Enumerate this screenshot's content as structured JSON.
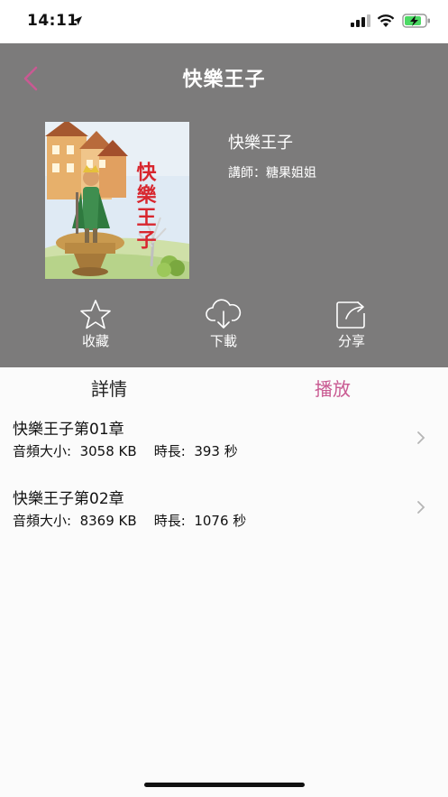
{
  "status_bar": {
    "time": "14:11"
  },
  "header": {
    "title": "快樂王子",
    "accent_color": "#c95a92",
    "book_title": "快樂王子",
    "teacher": "講師：糖果姐姐",
    "cover_text": "快樂王子"
  },
  "actions": {
    "favorite_label": "收藏",
    "download_label": "下載",
    "share_label": "分享"
  },
  "tabs": {
    "details_label": "詳情",
    "play_label": "播放",
    "active": "播放"
  },
  "episodes": [
    {
      "name": "快樂王子第01章",
      "meta": "音頻大小:  3058 KB    時長:  393 秒"
    },
    {
      "name": "快樂王子第02章",
      "meta": "音頻大小:  8369 KB    時長:  1076 秒"
    }
  ]
}
